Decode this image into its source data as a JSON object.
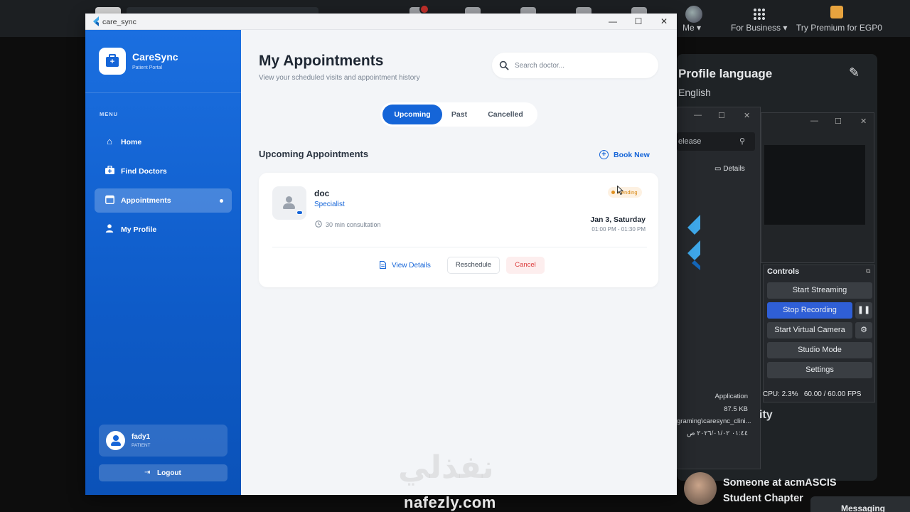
{
  "background": {
    "topbar": {
      "me_label": "Me",
      "business_label": "For Business",
      "premium_label": "Try Premium for EGP0"
    },
    "profile_panel": {
      "title": "Profile language",
      "language": "English",
      "partial_section_title": "ity"
    },
    "obs": {
      "search_text": "elease",
      "details_label": "Details",
      "controls_title": "Controls",
      "buttons": [
        "Start Streaming",
        "Stop Recording",
        "Start Virtual Camera",
        "Studio Mode",
        "Settings"
      ],
      "cpu": "CPU: 2.3%",
      "fps": "60.00 / 60.00 FPS",
      "file_type": "Application",
      "file_size": "87.5 KB",
      "file_path": "graming\\caresync_clini...",
      "file_date": "٠١:٤٤ ٢٠٢٦/٠١/٠٢ ص"
    },
    "notification": {
      "line1": "Someone at acmASCIS",
      "line2": "Student Chapter"
    },
    "messaging_label": "Messaging",
    "watermark_ar": "نفذلي",
    "watermark_en": "nafezly.com"
  },
  "window": {
    "title": "care_sync",
    "minimize": "—",
    "maximize": "☐",
    "close": "✕"
  },
  "sidebar": {
    "brand_name": "CareSync",
    "brand_subtitle": "Patient Portal",
    "menu_label": "MENU",
    "items": [
      {
        "label": "Home",
        "icon": "home-icon"
      },
      {
        "label": "Find Doctors",
        "icon": "medical-bag-icon"
      },
      {
        "label": "Appointments",
        "icon": "calendar-icon"
      },
      {
        "label": "My Profile",
        "icon": "person-icon"
      }
    ],
    "active_index": 2,
    "user": {
      "name": "fady1",
      "role": "PATIENT"
    },
    "logout_label": "Logout"
  },
  "main": {
    "title": "My Appointments",
    "subtitle": "View your scheduled visits and appointment history",
    "search_placeholder": "Search doctor...",
    "tabs": [
      "Upcoming",
      "Past",
      "Cancelled"
    ],
    "active_tab": 0,
    "section_title": "Upcoming Appointments",
    "book_new_label": "Book New",
    "appointments": [
      {
        "doctor": "doc",
        "specialty": "Specialist",
        "duration": "30 min consultation",
        "status": "Pending",
        "date": "Jan 3, Saturday",
        "time": "01:00 PM - 01:30 PM",
        "view_details_label": "View Details",
        "reschedule_label": "Reschedule",
        "cancel_label": "Cancel"
      }
    ]
  },
  "colors": {
    "primary": "#1565d8",
    "sidebar_top": "#1b6fe0",
    "sidebar_bottom": "#0b52b8",
    "pending": "#e0901e",
    "cancel": "#dc3b3b",
    "obs_blue": "#2f5fd6"
  }
}
